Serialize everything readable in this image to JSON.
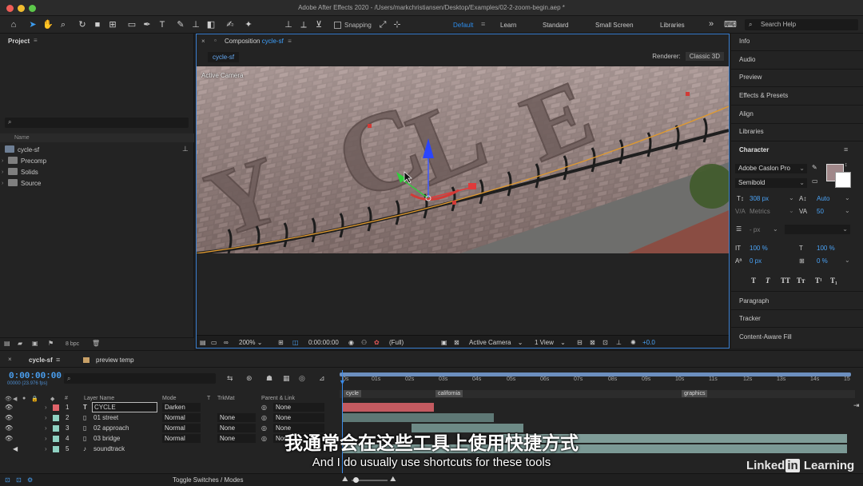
{
  "window": {
    "title": "Adobe After Effects 2020 - /Users/markchristiansen/Desktop/Examples/02-2-zoom-begin.aep *"
  },
  "toolbar": {
    "snapping_label": "Snapping",
    "workspaces": [
      "Default",
      "Learn",
      "Standard",
      "Small Screen",
      "Libraries"
    ],
    "active_workspace": "Default",
    "more": "»",
    "search_help_placeholder": "Search Help"
  },
  "project": {
    "tab_label": "Project",
    "header_name": "Name",
    "items": [
      {
        "label": "cycle-sf",
        "icon": "composition-icon"
      },
      {
        "label": "Precomp",
        "icon": "folder-icon"
      },
      {
        "label": "Solids",
        "icon": "folder-icon"
      },
      {
        "label": "Source",
        "icon": "folder-icon"
      }
    ],
    "bpc": "8 bpc"
  },
  "composition": {
    "tab_prefix": "Composition",
    "tab_name": "cycle-sf",
    "sub_tab": "cycle-sf",
    "renderer_label": "Renderer:",
    "renderer_value": "Classic 3D",
    "viewer_label": "Active Camera",
    "zoom": "200%",
    "timecode": "0:00:00:00",
    "resolution": "(Full)",
    "view": "Active Camera",
    "views": "1 View",
    "exposure": "+0.0"
  },
  "right_panel": {
    "items": [
      "Info",
      "Audio",
      "Preview",
      "Effects & Presets",
      "Align",
      "Libraries"
    ],
    "character": {
      "title": "Character",
      "font_family": "Adobe Caslon Pro",
      "font_style": "Semibold",
      "font_size": "308 px",
      "leading": "Auto",
      "kerning": "Metrics",
      "tracking": "50",
      "stroke_width": "- px",
      "vertical_scale": "100 %",
      "horizontal_scale": "100 %",
      "baseline_shift": "0 px",
      "tsume": "0 %",
      "style_buttons": [
        "T",
        "T",
        "TT",
        "Tт",
        "T¹",
        "T₁"
      ],
      "fill_color": "#a08789"
    },
    "bottom_items": [
      "Paragraph",
      "Tracker",
      "Content-Aware Fill"
    ]
  },
  "timeline": {
    "tabs": [
      "cycle-sf",
      "preview temp"
    ],
    "timecode": "0:00:00:00",
    "fps": "00000 (23.976 fps)",
    "columns": {
      "num": "#",
      "layer_name": "Layer Name",
      "mode": "Mode",
      "t": "T",
      "trkmat": "TrkMat",
      "parent": "Parent & Link"
    },
    "ruler_ticks": [
      "0s",
      "01s",
      "02s",
      "03s",
      "04s",
      "05s",
      "06s",
      "07s",
      "08s",
      "09s",
      "10s",
      "11s",
      "12s",
      "13s",
      "14s",
      "15"
    ],
    "markers": [
      "cycle",
      "california",
      "graphics"
    ],
    "layers": [
      {
        "num": "1",
        "type": "T",
        "name": "CYCLE",
        "mode": "Darken",
        "trkmat": "",
        "parent": "None",
        "label_color": "#e0636a"
      },
      {
        "num": "2",
        "type": "footage",
        "name": "01 street",
        "mode": "Normal",
        "trkmat": "None",
        "parent": "None",
        "label_color": "#8fd1c2"
      },
      {
        "num": "3",
        "type": "footage",
        "name": "02 approach",
        "mode": "Normal",
        "trkmat": "None",
        "parent": "None",
        "label_color": "#8fd1c2"
      },
      {
        "num": "4",
        "type": "footage",
        "name": "03 bridge",
        "mode": "Normal",
        "trkmat": "None",
        "parent": "None",
        "label_color": "#8fd1c2"
      },
      {
        "num": "5",
        "type": "audio",
        "name": "soundtrack",
        "mode": "",
        "trkmat": "",
        "parent": "",
        "label_color": "#8fd1c2"
      }
    ],
    "toggle_label": "Toggle Switches / Modes"
  },
  "subtitles": {
    "chinese": "我通常会在这些工具上使用快捷方式",
    "english": "And I do usually use shortcuts for these tools"
  },
  "watermark": {
    "pre": "Linked",
    "in": "in",
    "post": " Learning"
  }
}
